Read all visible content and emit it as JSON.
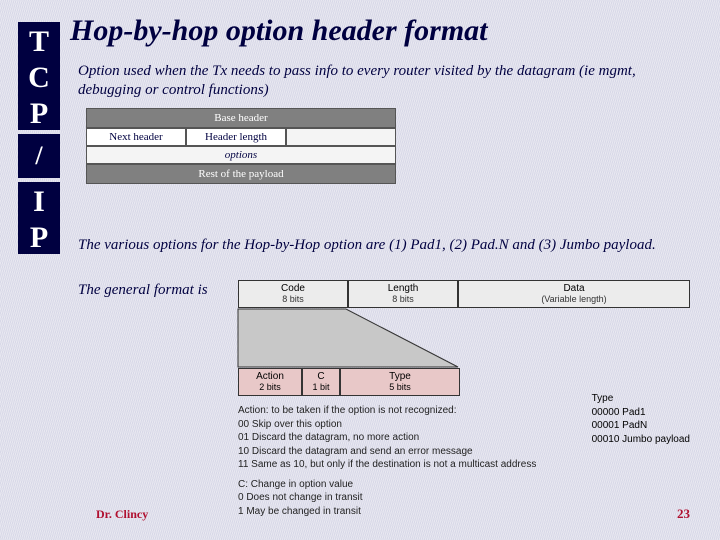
{
  "sidebar": {
    "top": "T\nC\nP",
    "mid": "/",
    "bot": "I\nP"
  },
  "title": "Hop-by-hop option header format",
  "intro": "Option used when the Tx needs to pass info to every router visited by the datagram (ie mgmt, debugging or control functions)",
  "fig1": {
    "base": "Base header",
    "nh": "Next header",
    "hl": "Header length",
    "opts": "options",
    "rest": "Rest of the payload"
  },
  "para2": "The various options for the Hop-by-Hop option are (1) Pad1, (2) Pad.N and (3) Jumbo payload.",
  "para3": "The general format is",
  "fig2": {
    "c1": "Code",
    "c1s": "8 bits",
    "c2": "Length",
    "c2s": "8 bits",
    "c3": "Data",
    "c3s": "(Variable length)",
    "b1": "Action",
    "b1s": "2 bits",
    "b2": "C",
    "b2s": "1 bit",
    "b3": "Type",
    "b3s": "5 bits",
    "legA": "Action: to be taken if the option is not recognized:",
    "a00": "00  Skip over this option",
    "a01": "01  Discard the datagram, no more action",
    "a10": "10  Discard the datagram and send an error message",
    "a11": "11  Same as 10, but only if the destination is not a multicast address",
    "legC": "C: Change in option value",
    "c0": "0  Does not change in transit",
    "c1v": "1  May be changed in transit",
    "rh": "Type",
    "r1": "00000  Pad1",
    "r2": "00001  PadN",
    "r3": "00010  Jumbo payload"
  },
  "footer": {
    "author": "Dr. Clincy",
    "page": "23"
  }
}
